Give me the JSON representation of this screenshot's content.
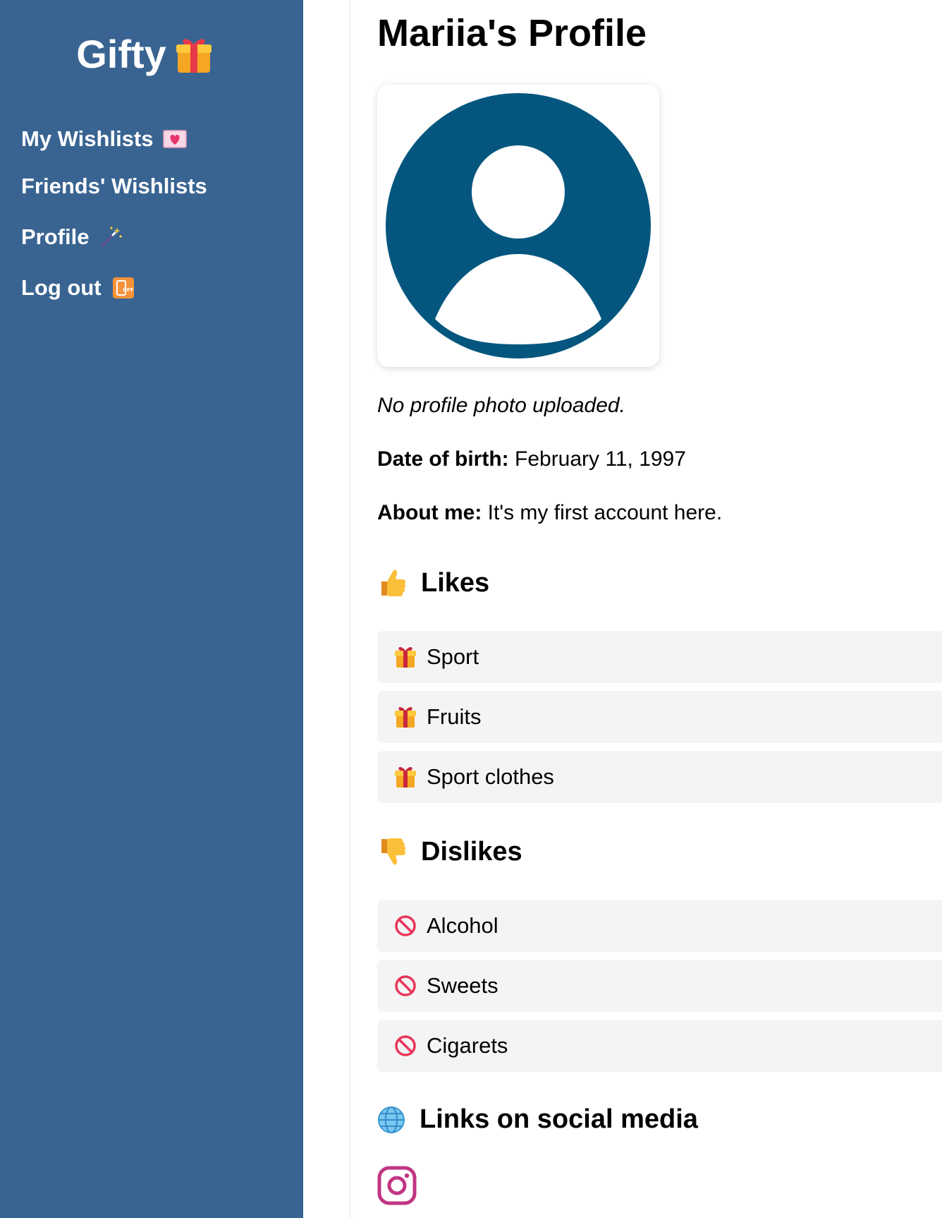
{
  "sidebar": {
    "logo_text": "Gifty",
    "items": [
      {
        "label": "My Wishlists",
        "icon": "love-letter-icon"
      },
      {
        "label": "Friends' Wishlists",
        "icon": ""
      },
      {
        "label": "Profile",
        "icon": "magic-wand-icon"
      },
      {
        "label": "Log out",
        "icon": "phone-off-icon"
      }
    ],
    "bg_color": "#396492"
  },
  "main": {
    "title": "Mariia's Profile",
    "no_photo": "No profile photo uploaded.",
    "dob_label": "Date of birth:",
    "dob_value": "February 11, 1997",
    "about_label": "About me:",
    "about_value": "It's my first account here.",
    "avatar_color": "#04567e",
    "likes": {
      "title": "Likes",
      "icon": "thumbs-up-icon",
      "items": [
        {
          "label": "Sport",
          "icon": "gift-icon"
        },
        {
          "label": "Fruits",
          "icon": "gift-icon"
        },
        {
          "label": "Sport clothes",
          "icon": "gift-icon"
        }
      ]
    },
    "dislikes": {
      "title": "Dislikes",
      "icon": "thumbs-down-icon",
      "items": [
        {
          "label": "Alcohol",
          "icon": "prohibited-icon"
        },
        {
          "label": "Sweets",
          "icon": "prohibited-icon"
        },
        {
          "label": "Cigarets",
          "icon": "prohibited-icon"
        }
      ]
    },
    "links": {
      "title": "Links on social media",
      "icon": "globe-icon",
      "items": [
        {
          "icon": "instagram-icon",
          "color": "#c13584"
        }
      ]
    }
  }
}
